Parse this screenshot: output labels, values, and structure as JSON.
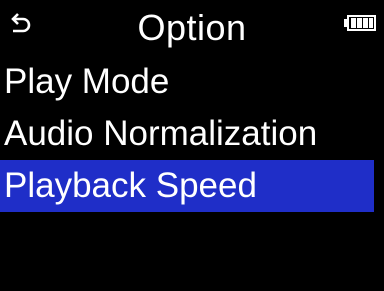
{
  "header": {
    "title": "Option",
    "back_icon": "return-arrow-icon",
    "battery_icon": "battery-icon"
  },
  "menu": {
    "items": [
      {
        "label": "Play Mode",
        "selected": false
      },
      {
        "label": "Audio Normalization",
        "selected": false
      },
      {
        "label": "Playback Speed",
        "selected": true
      }
    ]
  },
  "colors": {
    "background": "#000000",
    "text": "#ffffff",
    "selection": "#1f2ec8"
  }
}
